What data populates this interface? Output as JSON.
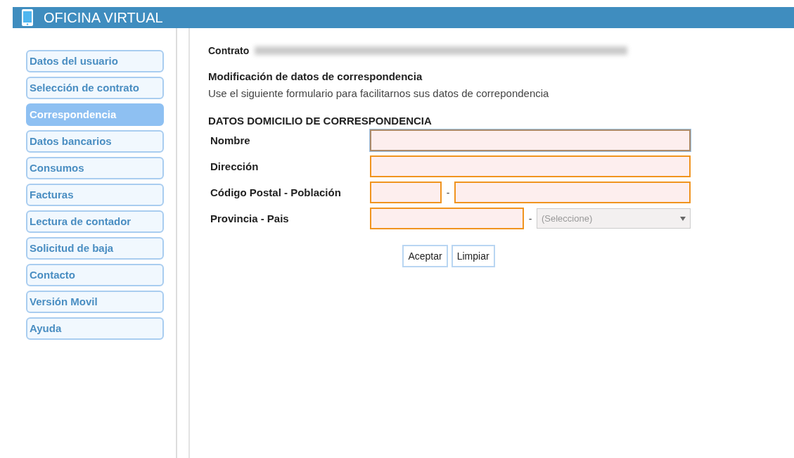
{
  "header": {
    "title": "OFICINA VIRTUAL"
  },
  "sidebar": {
    "items": [
      {
        "label": "Datos del usuario",
        "selected": false
      },
      {
        "label": "Selección de contrato",
        "selected": false
      },
      {
        "label": "Correspondencia",
        "selected": true
      },
      {
        "label": "Datos bancarios",
        "selected": false
      },
      {
        "label": "Consumos",
        "selected": false
      },
      {
        "label": "Facturas",
        "selected": false
      },
      {
        "label": "Lectura de contador",
        "selected": false
      },
      {
        "label": "Solicitud de baja",
        "selected": false
      },
      {
        "label": "Contacto",
        "selected": false
      },
      {
        "label": "Versión Movil",
        "selected": false
      },
      {
        "label": "Ayuda",
        "selected": false
      }
    ]
  },
  "contract": {
    "label": "Contrato"
  },
  "heading": "Modificación de datos de correspondencia",
  "intro": "Use el siguiente formulario para facilitarnos sus datos de correpondencia",
  "section_title": "DATOS DOMICILIO DE CORRESPONDENCIA",
  "form": {
    "rows": [
      {
        "label": "Nombre",
        "separator": null,
        "inputs": [
          {
            "kind": "text",
            "focused": true
          }
        ]
      },
      {
        "label": "Dirección",
        "separator": null,
        "inputs": [
          {
            "kind": "text",
            "focused": false
          }
        ]
      },
      {
        "label": "Código Postal - Población",
        "separator": "-",
        "inputs": [
          {
            "kind": "text",
            "focused": false
          },
          {
            "kind": "text",
            "focused": false
          }
        ]
      },
      {
        "label": "Provincia - Pais",
        "separator": "-",
        "inputs": [
          {
            "kind": "text",
            "focused": false
          },
          {
            "kind": "select",
            "value": "(Seleccione)",
            "disabled": true
          }
        ]
      }
    ]
  },
  "buttons": [
    "Aceptar",
    "Limpiar"
  ]
}
